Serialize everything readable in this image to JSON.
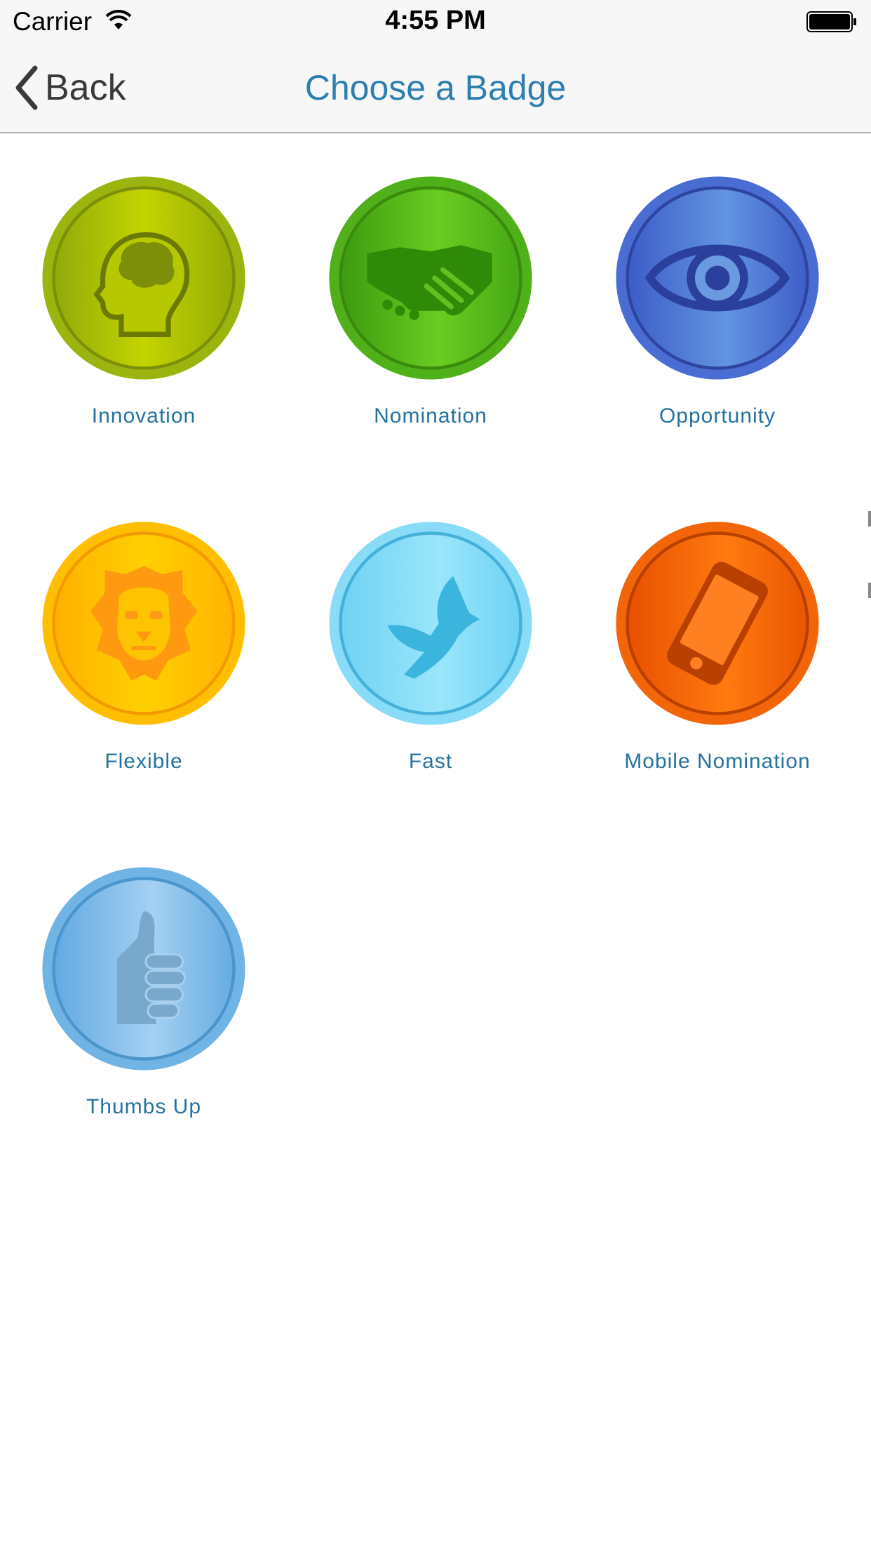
{
  "status_bar": {
    "carrier": "Carrier",
    "time": "4:55 PM"
  },
  "nav": {
    "back_label": "Back",
    "title": "Choose a Badge"
  },
  "badges": [
    {
      "label": "Innovation",
      "icon": "brain-head-icon",
      "color": "#a8c000"
    },
    {
      "label": "Nomination",
      "icon": "handshake-icon",
      "color": "#4cb31c"
    },
    {
      "label": "Opportunity",
      "icon": "eye-icon",
      "color": "#4a70d6"
    },
    {
      "label": "Flexible",
      "icon": "lion-icon",
      "color": "#ffbe00"
    },
    {
      "label": "Fast",
      "icon": "dove-icon",
      "color": "#78d8f5"
    },
    {
      "label": "Mobile Nomination",
      "icon": "mobile-phone-icon",
      "color": "#f2660a"
    },
    {
      "label": "Thumbs Up",
      "icon": "thumbs-up-icon",
      "color": "#6ab0e4"
    }
  ],
  "colors": {
    "accent": "#2d7fb0",
    "label": "#2472a0",
    "nav_background": "#f7f7f7"
  }
}
